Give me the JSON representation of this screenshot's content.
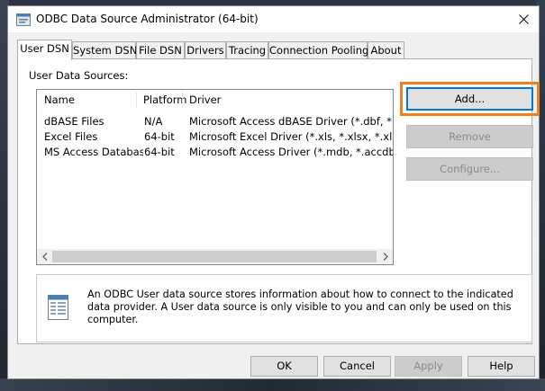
{
  "window": {
    "title": "ODBC Data Source Administrator (64-bit)"
  },
  "tabs": [
    {
      "label": "User DSN",
      "active": true
    },
    {
      "label": "System DSN",
      "active": false
    },
    {
      "label": "File DSN",
      "active": false
    },
    {
      "label": "Drivers",
      "active": false
    },
    {
      "label": "Tracing",
      "active": false
    },
    {
      "label": "Connection Pooling",
      "active": false
    },
    {
      "label": "About",
      "active": false
    }
  ],
  "user_dsn": {
    "section_label": "User Data Sources:",
    "columns": [
      "Name",
      "Platform",
      "Driver"
    ],
    "rows": [
      {
        "name": "dBASE Files",
        "platform": "N/A",
        "driver": "Microsoft Access dBASE Driver (*.dbf, *.ndx, *.m"
      },
      {
        "name": "Excel Files",
        "platform": "64-bit",
        "driver": "Microsoft Excel Driver (*.xls, *.xlsx, *.xlsm, *.xlsb)"
      },
      {
        "name": "MS Access Database",
        "platform": "64-bit",
        "driver": "Microsoft Access Driver (*.mdb, *.accdb)"
      }
    ],
    "buttons": {
      "add": "Add...",
      "remove": "Remove",
      "configure": "Configure..."
    },
    "info_text": "An ODBC User data source stores information about how to connect to the indicated data provider.   A User data source is only visible to you and can only be used on this computer."
  },
  "dialog_buttons": {
    "ok": "OK",
    "cancel": "Cancel",
    "apply": "Apply",
    "help": "Help"
  },
  "colors": {
    "highlight": "#f07f1f",
    "focus_border": "#0078d7",
    "disabled_text": "#8a8a8a"
  },
  "icons": {
    "app": "odbc-app-icon",
    "close": "close-icon",
    "info": "document-info-icon",
    "scroll_left": "chevron-left-icon",
    "scroll_right": "chevron-right-icon"
  }
}
